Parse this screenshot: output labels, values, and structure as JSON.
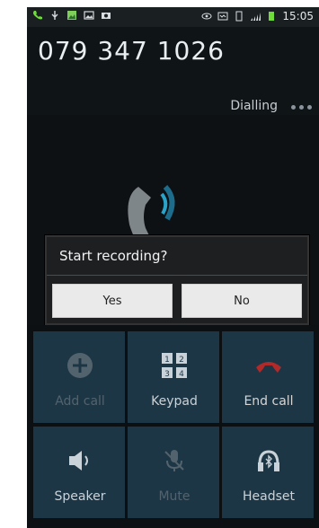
{
  "status": {
    "time": "15:05"
  },
  "call": {
    "number": "079 347 1026",
    "state": "Dialling"
  },
  "dialog": {
    "title": "Start recording?",
    "yes": "Yes",
    "no": "No"
  },
  "controls": [
    {
      "label": "Add call",
      "enabled": false,
      "icon": "plus-circle-icon"
    },
    {
      "label": "Keypad",
      "enabled": true,
      "icon": "keypad-icon"
    },
    {
      "label": "End call",
      "enabled": true,
      "icon": "end-call-icon"
    },
    {
      "label": "Speaker",
      "enabled": true,
      "icon": "speaker-icon"
    },
    {
      "label": "Mute",
      "enabled": false,
      "icon": "mute-mic-icon"
    },
    {
      "label": "Headset",
      "enabled": true,
      "icon": "bluetooth-headset-icon"
    }
  ],
  "colors": {
    "accent": "#2aa3c9",
    "end_call": "#b02a2a",
    "control_bg": "#1d3646"
  }
}
